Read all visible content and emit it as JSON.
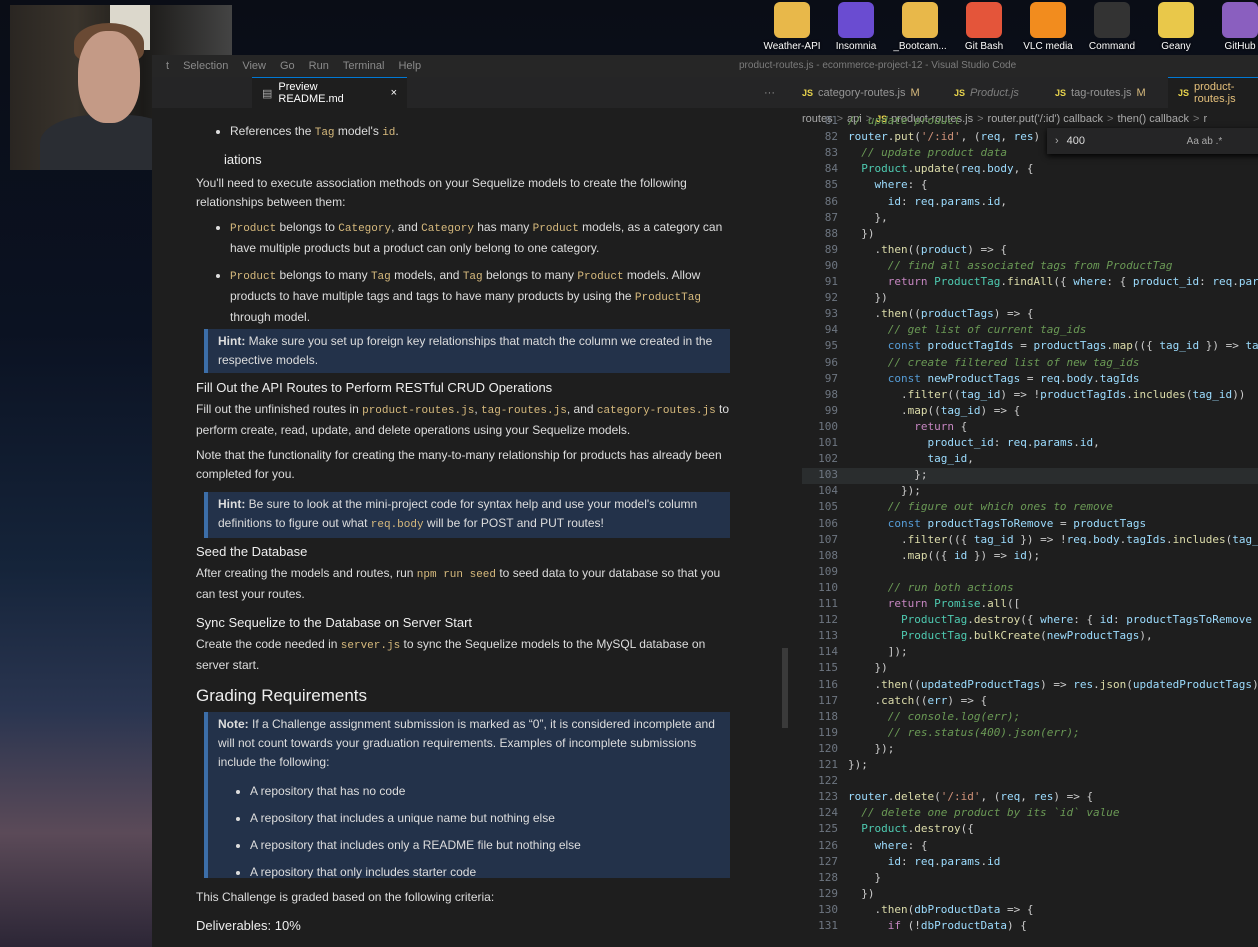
{
  "desktop": {
    "icons": [
      {
        "label": "Weather-API",
        "icon": "folder-icon",
        "color": "#e8b84a"
      },
      {
        "label": "Insomnia",
        "icon": "insomnia-icon",
        "color": "#6a4cd1"
      },
      {
        "label": "_Bootcam...",
        "icon": "folder-icon",
        "color": "#e8b84a"
      },
      {
        "label": "Git Bash",
        "icon": "git-icon",
        "color": "#e4553a"
      },
      {
        "label": "VLC media",
        "icon": "vlc-cone-icon",
        "color": "#f28c1e"
      },
      {
        "label": "Command",
        "icon": "terminal-icon",
        "color": "#333"
      },
      {
        "label": "Geany",
        "icon": "geany-icon",
        "color": "#e9c84a"
      },
      {
        "label": "GitHub",
        "icon": "github-icon",
        "color": "#8a5fbf"
      }
    ]
  },
  "vscode": {
    "menu": [
      "t",
      "Selection",
      "View",
      "Go",
      "Run",
      "Terminal",
      "Help"
    ],
    "window_title": "product-routes.js - ecommerce-project-12 - Visual Studio Code",
    "tabs": [
      {
        "label": "Preview README.md",
        "close": "×"
      },
      {
        "label": "category-routes.js",
        "mod": "M"
      },
      {
        "label": "Product.js",
        "mod": ""
      },
      {
        "label": "tag-routes.js",
        "mod": "M"
      },
      {
        "label": "product-routes.js",
        "mod": ""
      }
    ],
    "more": "···",
    "breadcrumb": [
      "routes",
      ">",
      "api",
      ">",
      "JS",
      "product-routes.js",
      ">",
      "router.put('/:id') callback",
      ">",
      "then() callback",
      ">",
      "r"
    ],
    "find": {
      "value": "400",
      "options": "Aa ab .*"
    }
  },
  "readme": {
    "bullet_ref": [
      "References the ",
      "Tag",
      " model's ",
      "id",
      "."
    ],
    "assoc_heading": "iations",
    "assoc_intro": "You'll need to execute association methods on your Sequelize models to create the following relationships between them:",
    "assoc_items": [
      [
        "Product",
        " belongs to ",
        "Category",
        ", and ",
        "Category",
        " has many ",
        "Product",
        " models, as a category can have multiple products but a product can only belong to one category."
      ],
      [
        "Product",
        " belongs to many ",
        "Tag",
        " models, and ",
        "Tag",
        " belongs to many ",
        "Product",
        " models. Allow products to have multiple tags and tags to have many products by using the ",
        "ProductTag",
        " through model."
      ]
    ],
    "hint1": [
      "Hint:",
      " Make sure you set up foreign key relationships that match the column we created in the respective models."
    ],
    "api_heading": "Fill Out the API Routes to Perform RESTful CRUD Operations",
    "api_text": [
      "Fill out the unfinished routes in ",
      "product-routes.js",
      ", ",
      "tag-routes.js",
      ", and ",
      "category-routes.js",
      " to perform create, read, update, and delete operations using your Sequelize models."
    ],
    "note_text": "Note that the functionality for creating the many-to-many relationship for products has already been completed for you.",
    "hint2": [
      "Hint:",
      " Be sure to look at the mini-project code for syntax help and use your model's column definitions to figure out what ",
      "req.body",
      " will be for POST and PUT routes!"
    ],
    "seed_heading": "Seed the Database",
    "seed_text": [
      "After creating the models and routes, run ",
      "npm run seed",
      " to seed data to your database so that you can test your routes."
    ],
    "sync_heading": "Sync Sequelize to the Database on Server Start",
    "sync_text": [
      "Create the code needed in ",
      "server.js",
      " to sync the Sequelize models to the MySQL database on server start."
    ],
    "grading_heading": "Grading Requirements",
    "note_block": [
      "Note:",
      " If a Challenge assignment submission is marked as “0”, it is considered incomplete and will not count towards your graduation requirements. Examples of incomplete submissions include the following:"
    ],
    "note_items": [
      "A repository that has no code",
      "A repository that includes a unique name but nothing else",
      "A repository that includes only a README file but nothing else",
      "A repository that only includes starter code"
    ],
    "criteria": "This Challenge is graded based on the following criteria:",
    "deliverables": "Deliverables: 10%"
  },
  "code_lines": [
    {
      "n": "81",
      "html": "<span class='c'>// update product</span>"
    },
    {
      "n": "82",
      "html": "<span class='v'>router</span>.<span class='f'>put</span>(<span class='s'>'/:id'</span>, (<span class='v'>req</span>, <span class='v'>res</span>) =&gt;"
    },
    {
      "n": "83",
      "html": "  <span class='c'>// update product data</span>"
    },
    {
      "n": "84",
      "html": "  <span class='t'>Product</span>.<span class='f'>update</span>(<span class='v'>req</span>.<span class='v'>body</span>, {"
    },
    {
      "n": "85",
      "html": "    <span class='v'>where</span>: {"
    },
    {
      "n": "86",
      "html": "      <span class='v'>id</span>: <span class='v'>req</span>.<span class='v'>params</span>.<span class='v'>id</span>,"
    },
    {
      "n": "87",
      "html": "    },"
    },
    {
      "n": "88",
      "html": "  })"
    },
    {
      "n": "89",
      "html": "    .<span class='f'>then</span>((<span class='v'>product</span>) =&gt; {"
    },
    {
      "n": "90",
      "html": "      <span class='c'>// find all associated tags from ProductTag</span>"
    },
    {
      "n": "91",
      "html": "      <span class='k'>return</span> <span class='t'>ProductTag</span>.<span class='f'>findAll</span>({ <span class='v'>where</span>: { <span class='v'>product_id</span>: <span class='v'>req</span>.<span class='v'>param</span>"
    },
    {
      "n": "92",
      "html": "    })"
    },
    {
      "n": "93",
      "html": "    .<span class='f'>then</span>((<span class='v'>productTags</span>) =&gt; {"
    },
    {
      "n": "94",
      "html": "      <span class='c'>// get list of current tag_ids</span>"
    },
    {
      "n": "95",
      "html": "      <span class='kb'>const</span> <span class='v'>productTagIds</span> = <span class='v'>productTags</span>.<span class='f'>map</span>(({ <span class='v'>tag_id</span> }) =&gt; <span class='v'>tag</span>"
    },
    {
      "n": "96",
      "html": "      <span class='c'>// create filtered list of new tag_ids</span>"
    },
    {
      "n": "97",
      "html": "      <span class='kb'>const</span> <span class='v'>newProductTags</span> = <span class='v'>req</span>.<span class='v'>body</span>.<span class='v'>tagIds</span>"
    },
    {
      "n": "98",
      "html": "        .<span class='f'>filter</span>((<span class='v'>tag_id</span>) =&gt; !<span class='v'>productTagIds</span>.<span class='f'>includes</span>(<span class='v'>tag_id</span>))"
    },
    {
      "n": "99",
      "html": "        .<span class='f'>map</span>((<span class='v'>tag_id</span>) =&gt; {"
    },
    {
      "n": "100",
      "html": "          <span class='k'>return</span> {"
    },
    {
      "n": "101",
      "html": "            <span class='v'>product_id</span>: <span class='v'>req</span>.<span class='v'>params</span>.<span class='v'>id</span>,"
    },
    {
      "n": "102",
      "html": "            <span class='v'>tag_id</span>,"
    },
    {
      "n": "103",
      "html": "          };"
    },
    {
      "n": "104",
      "html": "        });"
    },
    {
      "n": "105",
      "html": "      <span class='c'>// figure out which ones to remove</span>"
    },
    {
      "n": "106",
      "html": "      <span class='kb'>const</span> <span class='v'>productTagsToRemove</span> = <span class='v'>productTags</span>"
    },
    {
      "n": "107",
      "html": "        .<span class='f'>filter</span>(({ <span class='v'>tag_id</span> }) =&gt; !<span class='v'>req</span>.<span class='v'>body</span>.<span class='v'>tagIds</span>.<span class='f'>includes</span>(<span class='v'>tag_i</span>"
    },
    {
      "n": "108",
      "html": "        .<span class='f'>map</span>(({ <span class='v'>id</span> }) =&gt; <span class='v'>id</span>);"
    },
    {
      "n": "109",
      "html": ""
    },
    {
      "n": "110",
      "html": "      <span class='c'>// run both actions</span>"
    },
    {
      "n": "111",
      "html": "      <span class='k'>return</span> <span class='t'>Promise</span>.<span class='f'>all</span>(["
    },
    {
      "n": "112",
      "html": "        <span class='t'>ProductTag</span>.<span class='f'>destroy</span>({ <span class='v'>where</span>: { <span class='v'>id</span>: <span class='v'>productTagsToRemove</span> }"
    },
    {
      "n": "113",
      "html": "        <span class='t'>ProductTag</span>.<span class='f'>bulkCreate</span>(<span class='v'>newProductTags</span>),"
    },
    {
      "n": "114",
      "html": "      ]);"
    },
    {
      "n": "115",
      "html": "    })"
    },
    {
      "n": "116",
      "html": "    .<span class='f'>then</span>((<span class='v'>updatedProductTags</span>) =&gt; <span class='v'>res</span>.<span class='f'>json</span>(<span class='v'>updatedProductTags</span>))"
    },
    {
      "n": "117",
      "html": "    .<span class='f'>catch</span>((<span class='v'>err</span>) =&gt; {"
    },
    {
      "n": "118",
      "html": "      <span class='c'>// console.log(err);</span>"
    },
    {
      "n": "119",
      "html": "      <span class='c'>// res.status(400).json(err);</span>"
    },
    {
      "n": "120",
      "html": "    });"
    },
    {
      "n": "121",
      "html": "});"
    },
    {
      "n": "122",
      "html": ""
    },
    {
      "n": "123",
      "html": "<span class='v'>router</span>.<span class='f'>delete</span>(<span class='s'>'/:id'</span>, (<span class='v'>req</span>, <span class='v'>res</span>) =&gt; {"
    },
    {
      "n": "124",
      "html": "  <span class='c'>// delete one product by its `id` value</span>"
    },
    {
      "n": "125",
      "html": "  <span class='t'>Product</span>.<span class='f'>destroy</span>({"
    },
    {
      "n": "126",
      "html": "    <span class='v'>where</span>: {"
    },
    {
      "n": "127",
      "html": "      <span class='v'>id</span>: <span class='v'>req</span>.<span class='v'>params</span>.<span class='v'>id</span>"
    },
    {
      "n": "128",
      "html": "    }"
    },
    {
      "n": "129",
      "html": "  })"
    },
    {
      "n": "130",
      "html": "    .<span class='f'>then</span>(<span class='v'>dbProductData</span> =&gt; {"
    },
    {
      "n": "131",
      "html": "      <span class='k'>if</span> (!<span class='v'>dbProductData</span>) {"
    }
  ]
}
